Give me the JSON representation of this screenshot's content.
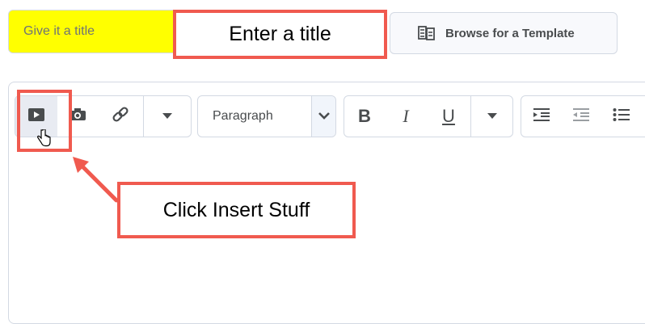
{
  "title_field": {
    "placeholder": "Give it a title",
    "background": "#ffff00"
  },
  "callouts": {
    "enter_title": "Enter a title",
    "insert_stuff": "Click Insert Stuff",
    "color": "#f05a4f"
  },
  "browse": {
    "label": "Browse for a Template",
    "icon": "template-icon"
  },
  "toolbar": {
    "group1": [
      {
        "name": "insert-stuff-button",
        "icon": "play-icon"
      },
      {
        "name": "insert-image-button",
        "icon": "camera-icon"
      },
      {
        "name": "insert-link-button",
        "icon": "link-icon"
      },
      {
        "name": "more-insert-dropdown",
        "icon": "caret-down-icon"
      }
    ],
    "paragraph_select": "Paragraph",
    "format": {
      "bold": "B",
      "italic": "I",
      "underline": "U"
    },
    "list_icons": [
      "indent-icon",
      "outdent-icon",
      "bullet-list-icon"
    ]
  }
}
